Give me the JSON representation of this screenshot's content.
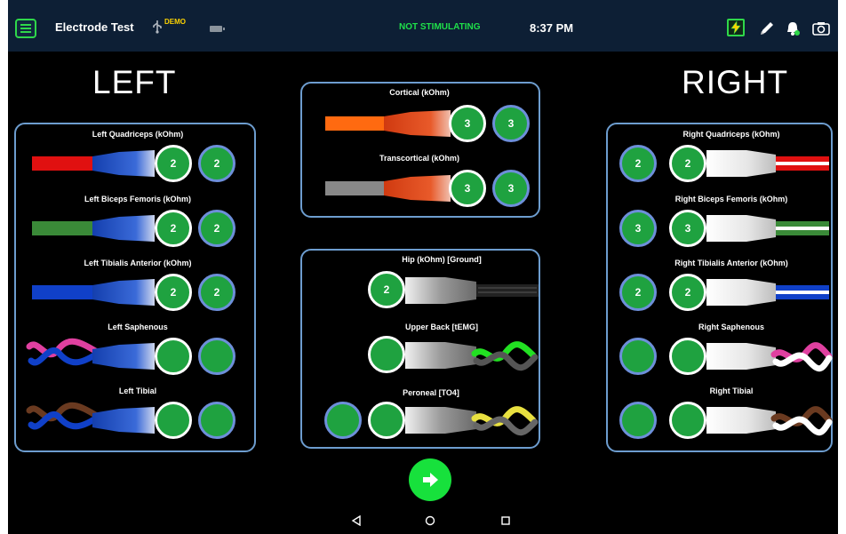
{
  "status_bar": {
    "app_title": "Electrode Test",
    "demo_label": "DEMO",
    "stimulation_status": "NOT STIMULATING",
    "time": "8:37 PM",
    "colors": {
      "accent_green": "#2fd84a",
      "bar_bg": "#0d1f35",
      "stim_text": "#1fe04a",
      "demo_text": "#ffd400"
    }
  },
  "left": {
    "title": "LEFT",
    "channels": [
      {
        "label": "Left Quadriceps (kOhm)",
        "values": [
          "2",
          "2"
        ],
        "wire_color": "#e01010"
      },
      {
        "label": "Left Biceps Femoris (kOhm)",
        "values": [
          "2",
          "2"
        ],
        "wire_color": "#3a8a38"
      },
      {
        "label": "Left Tibialis Anterior (kOhm)",
        "values": [
          "2",
          "2"
        ],
        "wire_color": "#1040c8"
      },
      {
        "label": "Left Saphenous",
        "values": [
          "",
          ""
        ],
        "wire_color": "#e040a0"
      },
      {
        "label": "Left Tibial",
        "values": [
          "",
          ""
        ],
        "wire_color": "#6a3a20"
      }
    ]
  },
  "center_top": {
    "channels": [
      {
        "label": "Cortical (kOhm)",
        "values": [
          "3",
          "3"
        ],
        "wire_color": "#ff6a10"
      },
      {
        "label": "Transcortical (kOhm)",
        "values": [
          "3",
          "3"
        ],
        "wire_color": "#888888"
      }
    ]
  },
  "center_bottom": {
    "channels": [
      {
        "label": "Hip (kOhm) [Ground]",
        "values": [
          "2"
        ],
        "wire_color": "#222222"
      },
      {
        "label": "Upper Back [tEMG]",
        "values": [
          ""
        ],
        "wire_color": "#22e022"
      },
      {
        "label": "Peroneal [TO4]",
        "values": [
          "",
          ""
        ],
        "wire_color": "#e8e040"
      }
    ]
  },
  "right": {
    "title": "RIGHT",
    "channels": [
      {
        "label": "Right Quadriceps (kOhm)",
        "values": [
          "2",
          "2"
        ],
        "wire_color": "#e01010"
      },
      {
        "label": "Right Biceps Femoris (kOhm)",
        "values": [
          "3",
          "3"
        ],
        "wire_color": "#3a8a38"
      },
      {
        "label": "Right Tibialis Anterior (kOhm)",
        "values": [
          "2",
          "2"
        ],
        "wire_color": "#1040c8"
      },
      {
        "label": "Right Saphenous",
        "values": [
          "",
          ""
        ],
        "wire_color": "#e040a0"
      },
      {
        "label": "Right Tibial",
        "values": [
          "",
          ""
        ],
        "wire_color": "#6a3a20"
      }
    ]
  },
  "icons": {
    "menu": "hamburger-menu-icon",
    "usb": "usb-icon",
    "battery": "battery-icon",
    "bolt": "lightning-bolt-icon",
    "pencil": "pencil-icon",
    "bell": "bell-icon",
    "camera": "camera-icon",
    "next": "arrow-right-icon",
    "nav_back": "back-triangle-icon",
    "nav_home": "home-circle-icon",
    "nav_recent": "recent-apps-square-icon"
  }
}
